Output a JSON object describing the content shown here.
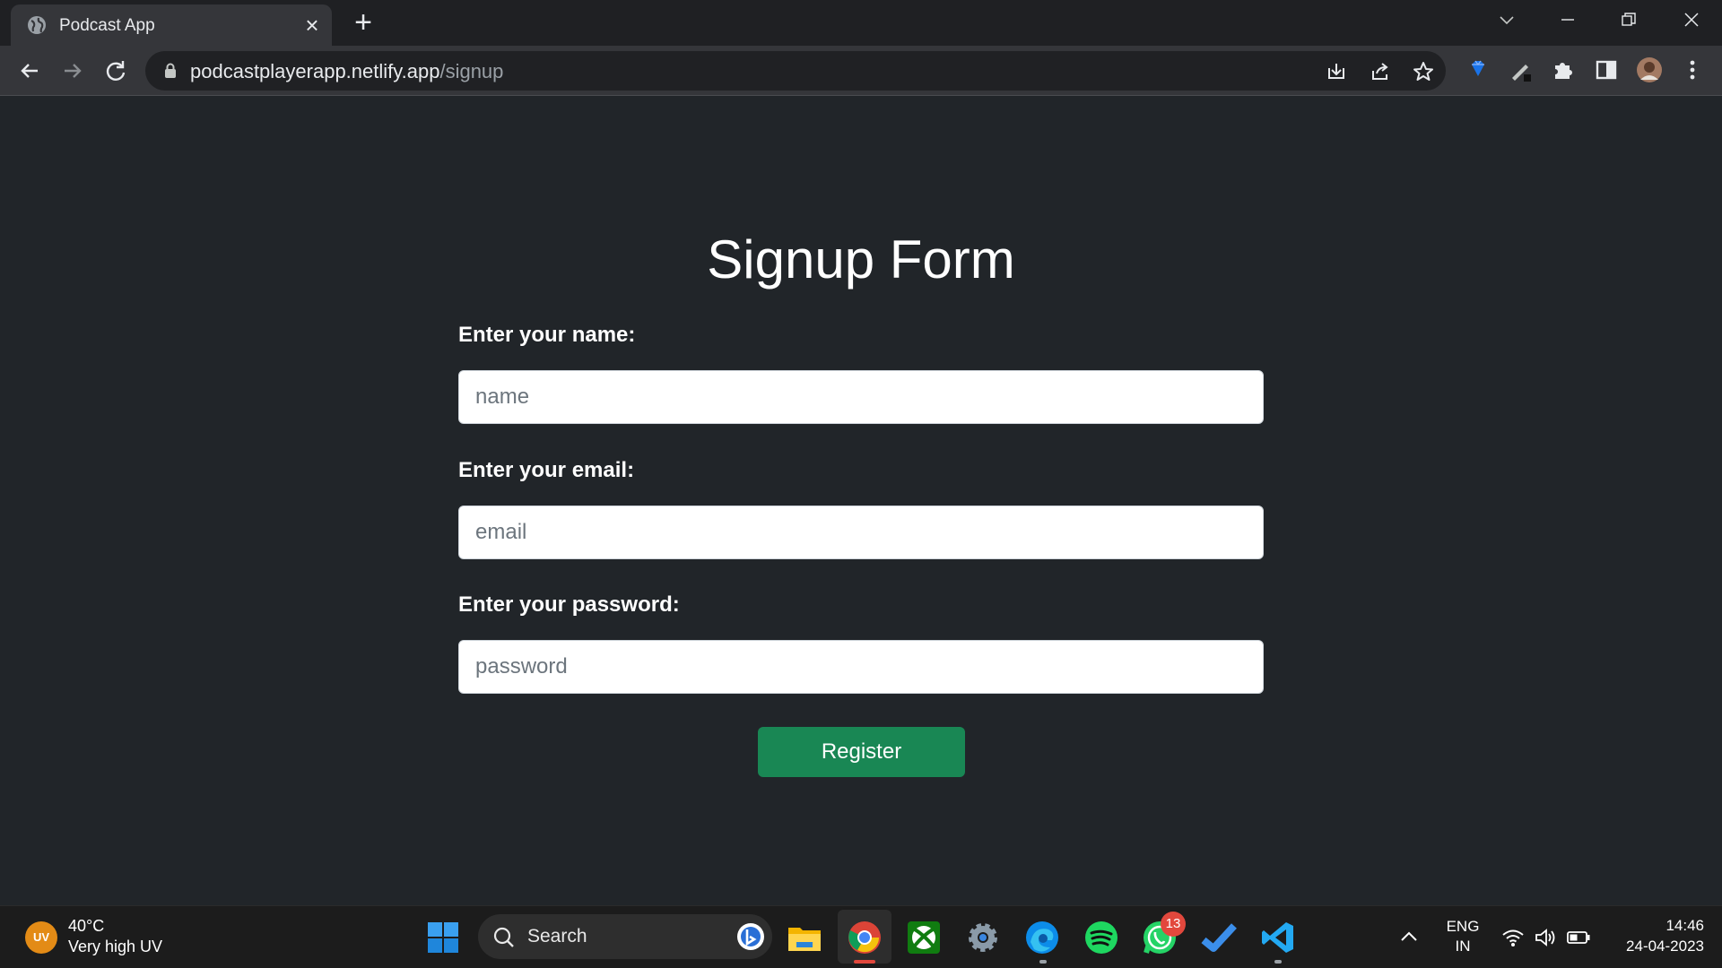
{
  "browser": {
    "tab_title": "Podcast App",
    "tab_close": "×",
    "new_tab": "+",
    "url_host": "podcastplayerapp.netlify.app",
    "url_path": "/signup"
  },
  "form": {
    "title": "Signup Form",
    "name_label": "Enter your name:",
    "name_placeholder": "name",
    "email_label": "Enter your email:",
    "email_placeholder": "email",
    "password_label": "Enter your password:",
    "password_placeholder": "password",
    "submit_label": "Register"
  },
  "taskbar": {
    "weather_icon_text": "UV",
    "weather_temp": "40°C",
    "weather_desc": "Very high UV",
    "search_label": "Search",
    "whatsapp_badge": "13",
    "lang_line1": "ENG",
    "lang_line2": "IN",
    "time": "14:46",
    "date": "24-04-2023"
  },
  "colors": {
    "page_bg": "#212529",
    "submit_bg": "#198754",
    "tab_bg": "#35363a",
    "taskbar_bg": "#1c1c1c"
  }
}
